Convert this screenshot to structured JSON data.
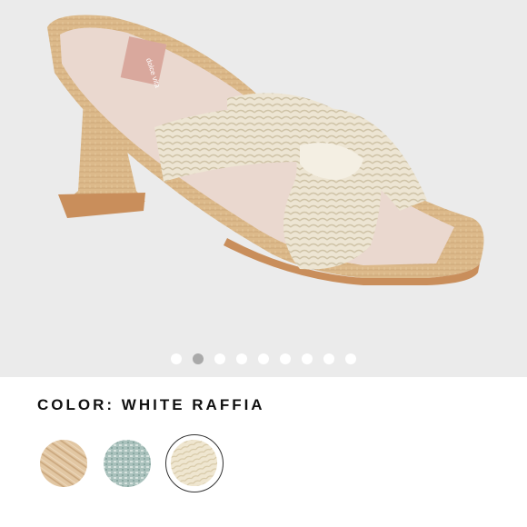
{
  "product": {
    "image_alt": "white raffia heeled mule sandal",
    "insole_brand_text": "dolce vita"
  },
  "gallery": {
    "dot_count": 9,
    "active_index": 1
  },
  "color": {
    "label": "COLOR: WHITE RAFFIA"
  },
  "swatches": [
    {
      "name": "natural raffia",
      "selected": false
    },
    {
      "name": "sage raffia",
      "selected": false
    },
    {
      "name": "white raffia",
      "selected": true
    }
  ],
  "colors": {
    "background": "#ebebeb",
    "raffia_tan": "#dcb98a",
    "raffia_white": "#ece4d2",
    "dot_active": "#a9a9a9"
  }
}
